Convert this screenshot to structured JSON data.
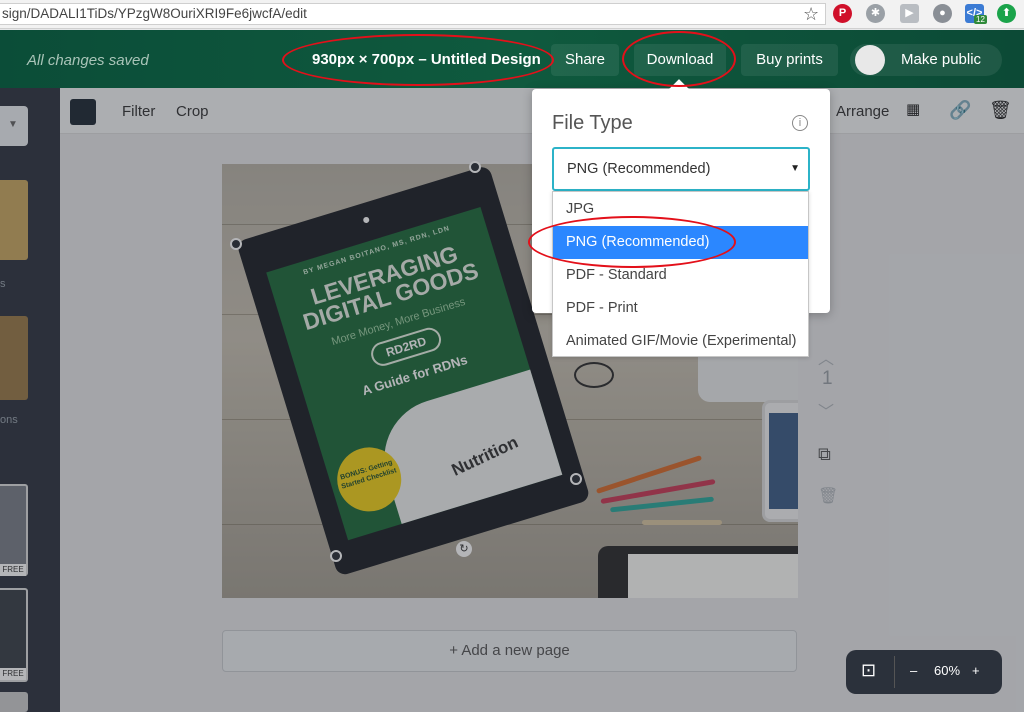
{
  "browser": {
    "url": "sign/DADALI1TiDs/YPzgW8OuriXRI9Fe6jwcfA/edit",
    "badge_count": "12"
  },
  "header": {
    "save_status": "All changes saved",
    "design_title": "930px × 700px – Untitled Design",
    "share_label": "Share",
    "download_label": "Download",
    "buy_prints_label": "Buy prints",
    "make_public_label": "Make public"
  },
  "sidebar": {
    "label_1": "s",
    "label_2": "ons",
    "free_1": "FREE",
    "free_2": "FREE"
  },
  "toolbar": {
    "filter_label": "Filter",
    "crop_label": "Crop",
    "arrange_label": "Arrange",
    "swatch_color": "#1e2833"
  },
  "canvas": {
    "book_byline": "BY MEGAN BOITANO, MS, RDN, LDN",
    "book_title": "LEVERAGING DIGITAL GOODS",
    "book_subtitle": "More Money, More Business",
    "book_logo": "RD2RD",
    "book_guide": "A Guide for RDNs",
    "book_bonus": "BONUS: Getting Started Checklist",
    "book_photo_text": "Nutrition"
  },
  "page_controls": {
    "page_number": "1"
  },
  "add_page_label": "+ Add a new page",
  "zoom": {
    "minus": "–",
    "level": "60%",
    "plus": "+"
  },
  "download_menu": {
    "title": "File Type",
    "selected_value": "PNG (Recommended)",
    "options": [
      "JPG",
      "PNG (Recommended)",
      "PDF - Standard",
      "PDF - Print",
      "Animated GIF/Movie (Experimental)"
    ],
    "highlighted_index": 1
  },
  "colors": {
    "topbar": "#0f5a3e",
    "select_border": "#2cb3c8",
    "highlight": "#2b87ff",
    "annotation_red": "#e3101a"
  }
}
